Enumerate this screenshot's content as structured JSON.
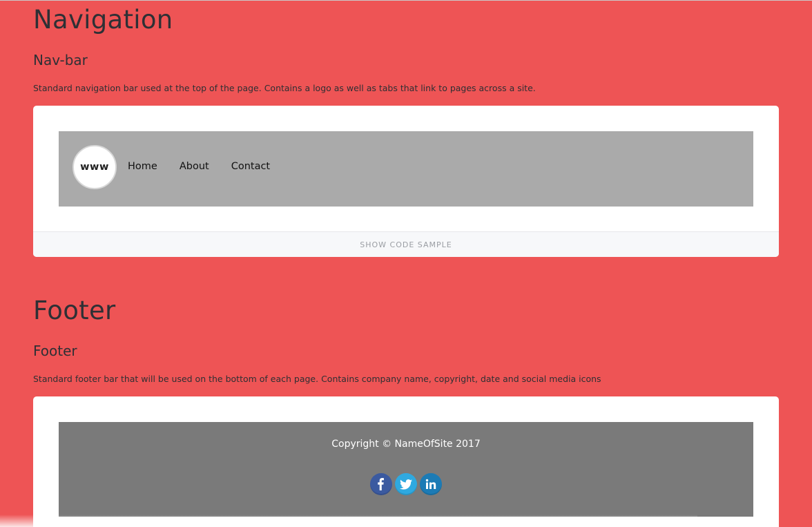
{
  "navigation_section": {
    "title": "Navigation",
    "subtitle": "Nav-bar",
    "description": "Standard navigation bar used at the top of the page. Contains a logo as well as tabs that link to pages across a site.",
    "demo": {
      "logo_text": "www",
      "links": [
        "Home",
        "About",
        "Contact"
      ]
    },
    "code_toggle_label": "SHOW CODE SAMPLE"
  },
  "footer_section": {
    "title": "Footer",
    "subtitle": "Footer",
    "description": "Standard footer bar that will be used on the bottom of each page. Contains company name, copyright, date and social media icons",
    "demo": {
      "copyright": "Copyright © NameOfSite 2017",
      "socials": [
        {
          "icon": "facebook-icon",
          "glyph": "f",
          "color": "#3b5aa0"
        },
        {
          "icon": "twitter-icon",
          "glyph": "🐦",
          "color": "#2fa9e0"
        },
        {
          "icon": "linkedin-icon",
          "glyph": "in",
          "color": "#1c7bb5"
        }
      ]
    }
  },
  "colors": {
    "page_background": "#ee5455",
    "nav_demo_background": "#aaaaaa",
    "footer_demo_background": "#7a7a7a"
  }
}
